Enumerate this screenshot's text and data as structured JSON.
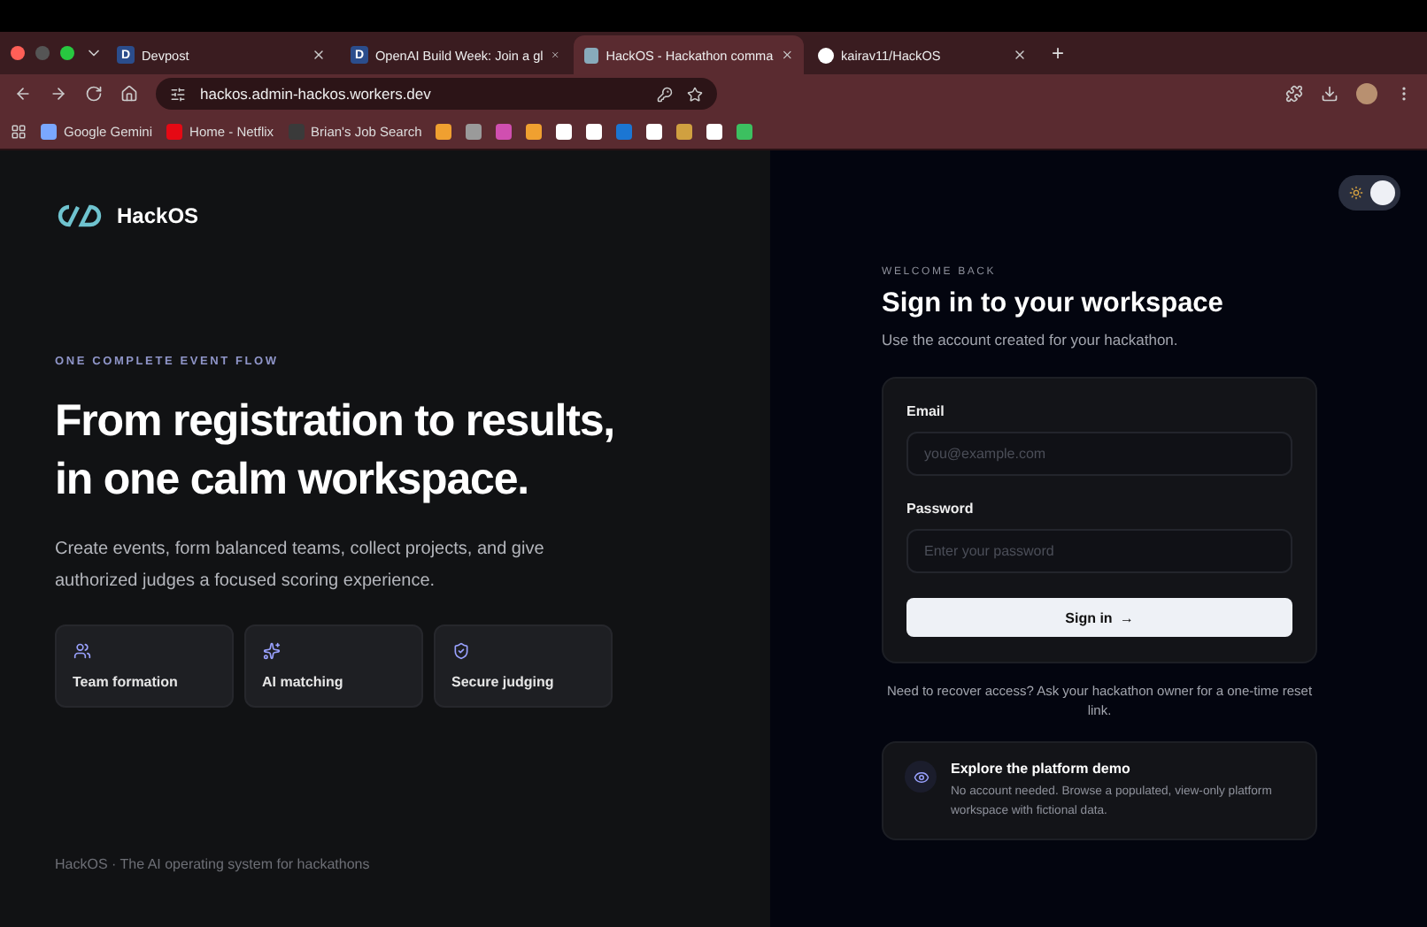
{
  "browser": {
    "tabs": [
      {
        "title": "Devpost",
        "icon": "D",
        "selected": false
      },
      {
        "title": "OpenAI Build Week: Join a gl",
        "icon": "D",
        "selected": false
      },
      {
        "title": "HackOS - Hackathon comma",
        "selected": true
      },
      {
        "title": "kairav11/HackOS",
        "selected": false
      }
    ],
    "new_tab": "+",
    "url": "hackos.admin-hackos.workers.dev",
    "bookmarks": [
      {
        "label": "Google Gemini",
        "color": "#7aa7ff"
      },
      {
        "label": "Home - Netflix",
        "color": "#e50914"
      },
      {
        "label": "Brian's Job Search",
        "color": "#3a3a3a"
      }
    ],
    "icon_bookmarks": [
      {
        "color": "#f0a030"
      },
      {
        "color": "#9a9a9a"
      },
      {
        "color": "#d04fb0"
      },
      {
        "color": "#f0a030"
      },
      {
        "color": "#ffffff"
      },
      {
        "color": "#ffffff"
      },
      {
        "color": "#1b76d3"
      },
      {
        "color": "#ffffff"
      },
      {
        "color": "#d0a040"
      },
      {
        "color": "#ffffff"
      },
      {
        "color": "#3cc060"
      }
    ]
  },
  "brand": {
    "name": "HackOS"
  },
  "hero": {
    "eyebrow": "ONE COMPLETE EVENT FLOW",
    "title_lines": [
      "From registration to results,",
      "in one calm workspace."
    ],
    "description": "Create events, form balanced teams, collect projects, and give authorized judges a focused scoring experience.",
    "features": [
      {
        "kind": "team",
        "label": "Team formation"
      },
      {
        "kind": "ai",
        "label": "AI matching"
      },
      {
        "kind": "secure",
        "label": "Secure judging"
      }
    ]
  },
  "footer": "HackOS · The AI operating system for hackathons",
  "theme_toggle": {
    "on": true
  },
  "signin": {
    "eyebrow": "WELCOME BACK",
    "title": "Sign in to your workspace",
    "subtitle": "Use the account created for your hackathon.",
    "fields": [
      {
        "label": "Email",
        "placeholder": "you@example.com"
      },
      {
        "label": "Password",
        "placeholder": "Enter your password"
      }
    ],
    "button": "Sign in",
    "arrow": "→",
    "recover": "Need to recover access? Ask your hackathon owner for a one-time reset link.",
    "demo": {
      "title": "Explore the platform demo",
      "text": "No account needed. Browse a populated, view-only platform workspace with fictional data."
    }
  }
}
